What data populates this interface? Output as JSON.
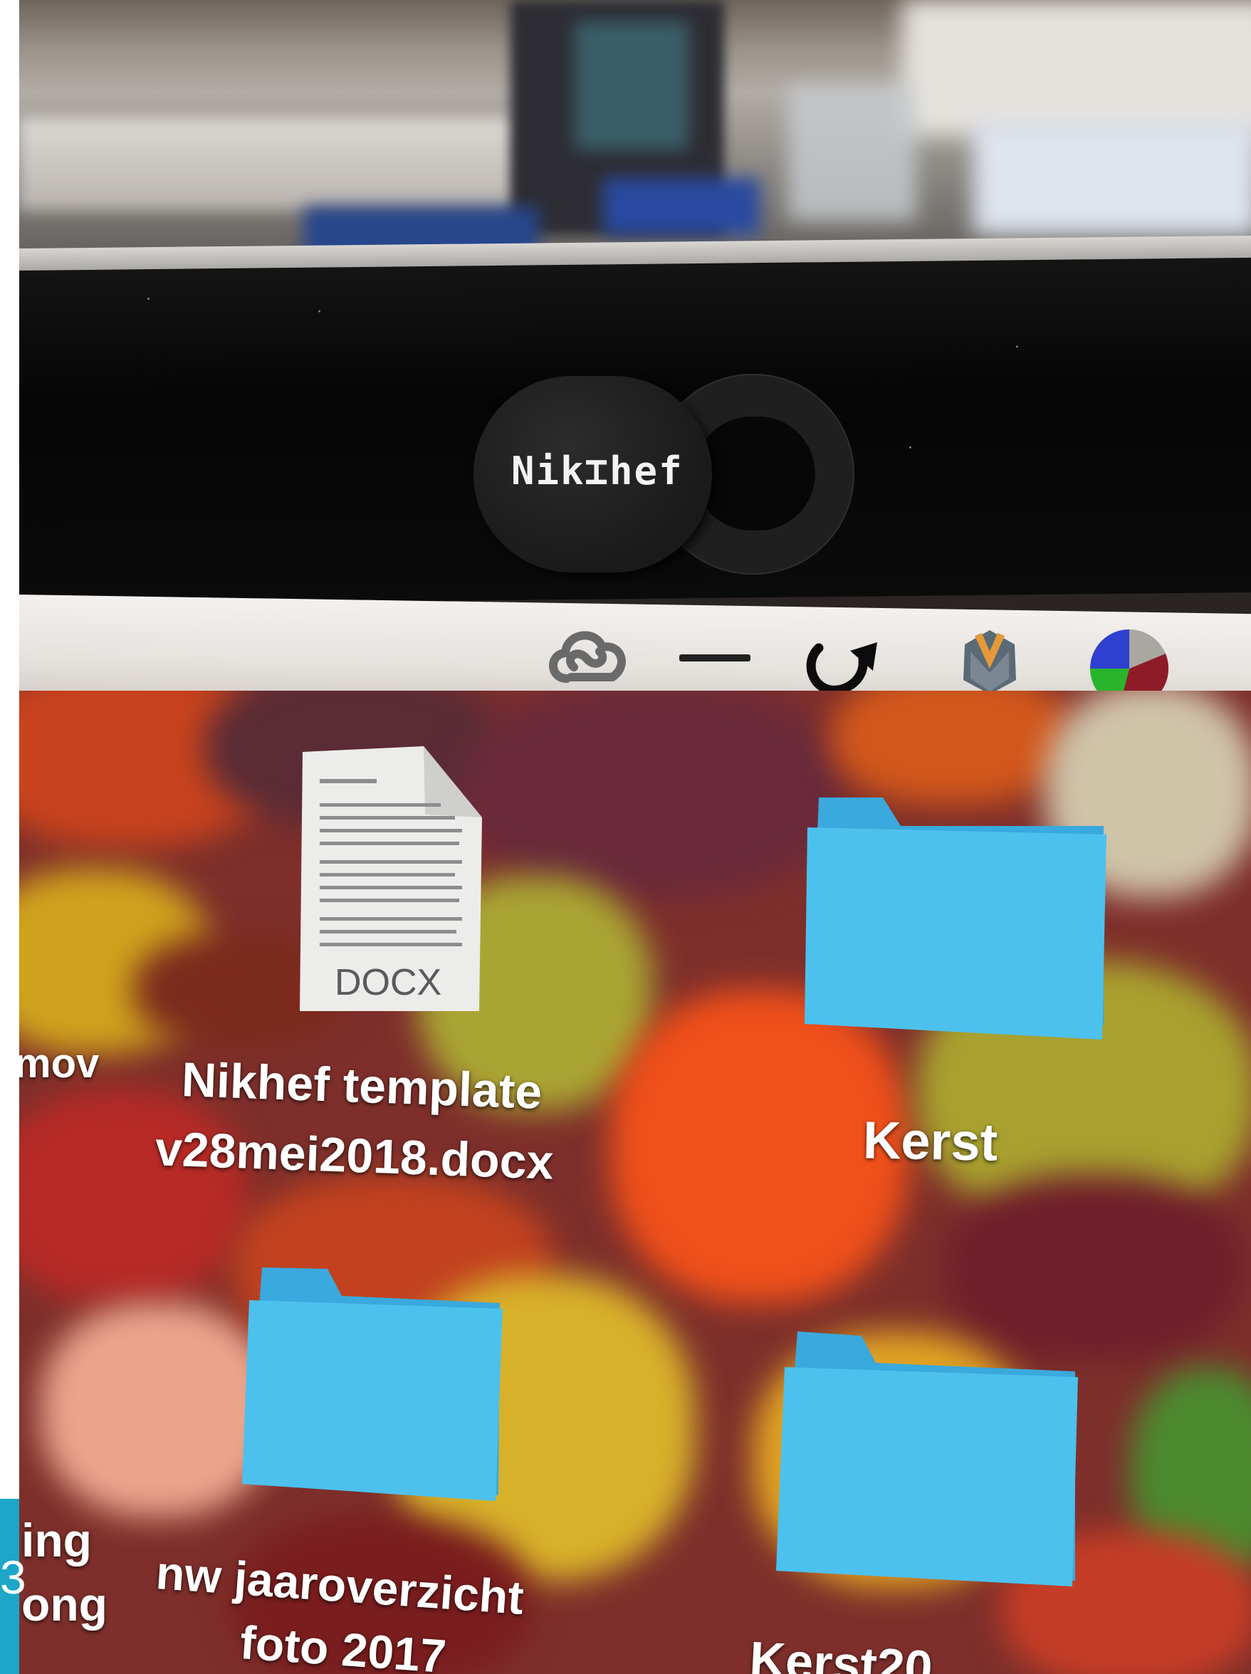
{
  "webcam_cover": {
    "logo_text": "Nik⌶hef"
  },
  "menubar": {
    "icons": [
      "creative-cloud-icon",
      "minus-icon",
      "sync-arrow-icon",
      "app-shield-icon",
      "pie-chart-icon"
    ],
    "pie_colors": [
      "#2f3fcf",
      "#a8a7a2",
      "#8e1c28",
      "#29b52b"
    ]
  },
  "desktop": {
    "left_edge_label": "mov",
    "docx_file": {
      "name_line1": "Nikhef template",
      "name_line2": "v28mei2018.docx",
      "icon_label": "DOCX"
    },
    "folder_kerst": {
      "name": "Kerst"
    },
    "bottom_left_partial": {
      "line1": "ing",
      "line2": "ong"
    },
    "folder_jaaroverzicht": {
      "name_line1": "nw jaaroverzicht",
      "name_line2": "foto 2017"
    },
    "folder_kerst2": {
      "name": "Kerst20"
    }
  },
  "corner_badge": {
    "digit": "3"
  },
  "colors": {
    "folder_blue": "#41b7e8",
    "folder_tab": "#5cc6f0"
  }
}
